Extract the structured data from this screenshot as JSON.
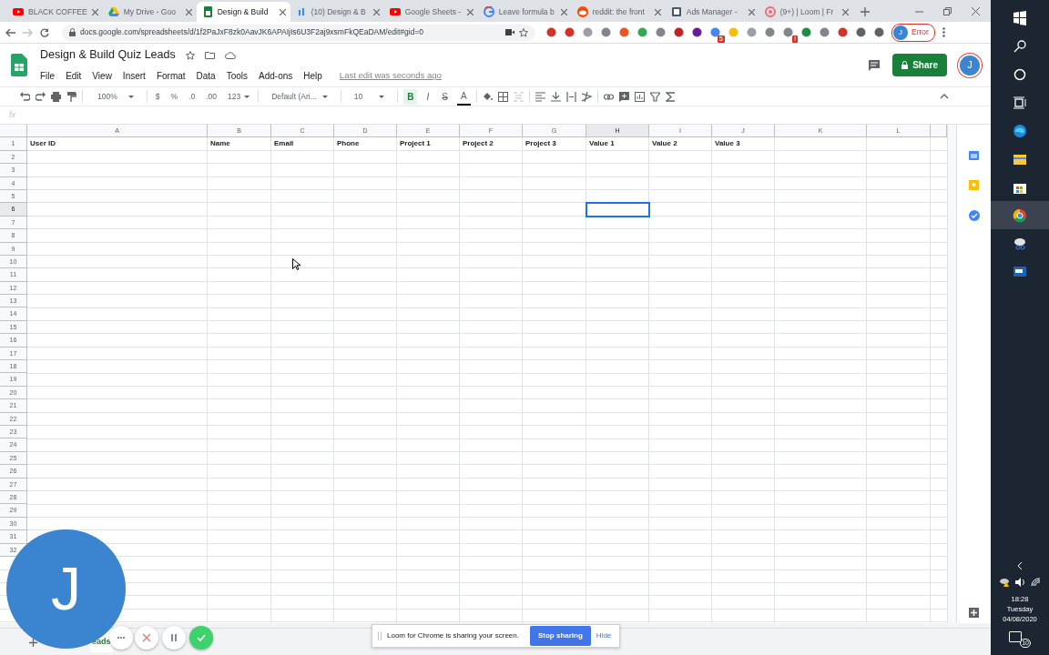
{
  "browser": {
    "tabs": [
      {
        "title": "BLACK COFFEE",
        "kind": "youtube",
        "selected": false
      },
      {
        "title": "My Drive - Goo",
        "kind": "drive",
        "selected": false
      },
      {
        "title": "Design & Build",
        "kind": "sheets",
        "selected": true
      },
      {
        "title": "(10) Design & B",
        "kind": "quiz",
        "selected": false
      },
      {
        "title": "Google Sheets -",
        "kind": "youtube",
        "selected": false
      },
      {
        "title": "Leave formula b",
        "kind": "google",
        "selected": false
      },
      {
        "title": "reddit: the front",
        "kind": "reddit",
        "selected": false
      },
      {
        "title": "Ads Manager -",
        "kind": "ads",
        "selected": false
      },
      {
        "title": "(9+) | Loom | Fr",
        "kind": "loom",
        "selected": false
      }
    ],
    "url": "docs.google.com/spreadsheets/d/1f2PaJxF8zk0AavJK6APAIjIs6U3F2aj9xsmFkQEaDAM/edit#gid=0",
    "extension_badges": [
      "5",
      "!"
    ],
    "profile": {
      "initial": "J",
      "status": "Error"
    }
  },
  "sheet": {
    "title": "Design & Build Quiz Leads",
    "menus": [
      "File",
      "Edit",
      "View",
      "Insert",
      "Format",
      "Data",
      "Tools",
      "Add-ons",
      "Help"
    ],
    "last_edit": "Last edit was seconds ago",
    "share": "Share",
    "avatar": "J",
    "toolbar": {
      "zoom": "100%",
      "currency": "$",
      "percent": "%",
      "decrease_decimal": ".0",
      "increase_decimal": ".00",
      "number_format": "123",
      "font": "Default (Ari...",
      "font_size": "10",
      "formatting": [
        {
          "label": "B",
          "kind": "bold",
          "on": true
        },
        {
          "label": "I",
          "kind": "italic",
          "on": false
        },
        {
          "label": "S",
          "kind": "strike",
          "on": false
        },
        {
          "label": "A",
          "kind": "color",
          "on": false
        }
      ]
    },
    "formula_bar": {
      "label": "fx"
    },
    "columns": [
      {
        "label": "A",
        "selected": false
      },
      {
        "label": "B",
        "selected": false
      },
      {
        "label": "C",
        "selected": false
      },
      {
        "label": "D",
        "selected": false
      },
      {
        "label": "E",
        "selected": false
      },
      {
        "label": "F",
        "selected": false
      },
      {
        "label": "G",
        "selected": false
      },
      {
        "label": "H",
        "selected": true
      },
      {
        "label": "I",
        "selected": false
      },
      {
        "label": "J",
        "selected": false
      },
      {
        "label": "K",
        "selected": false
      },
      {
        "label": "L",
        "selected": false
      }
    ],
    "rows": [
      {
        "label": "1",
        "selected": false
      },
      {
        "label": "2",
        "selected": false
      },
      {
        "label": "3",
        "selected": false
      },
      {
        "label": "4",
        "selected": false
      },
      {
        "label": "5",
        "selected": false
      },
      {
        "label": "6",
        "selected": true
      },
      {
        "label": "7",
        "selected": false
      },
      {
        "label": "8",
        "selected": false
      },
      {
        "label": "9",
        "selected": false
      },
      {
        "label": "10",
        "selected": false
      },
      {
        "label": "11",
        "selected": false
      },
      {
        "label": "12",
        "selected": false
      },
      {
        "label": "13",
        "selected": false
      },
      {
        "label": "14",
        "selected": false
      },
      {
        "label": "15",
        "selected": false
      },
      {
        "label": "16",
        "selected": false
      },
      {
        "label": "17",
        "selected": false
      },
      {
        "label": "18",
        "selected": false
      },
      {
        "label": "19",
        "selected": false
      },
      {
        "label": "20",
        "selected": false
      },
      {
        "label": "21",
        "selected": false
      },
      {
        "label": "22",
        "selected": false
      },
      {
        "label": "23",
        "selected": false
      },
      {
        "label": "24",
        "selected": false
      },
      {
        "label": "25",
        "selected": false
      },
      {
        "label": "26",
        "selected": false
      },
      {
        "label": "27",
        "selected": false
      },
      {
        "label": "28",
        "selected": false
      },
      {
        "label": "29",
        "selected": false
      },
      {
        "label": "30",
        "selected": false
      },
      {
        "label": "31",
        "selected": false
      },
      {
        "label": "32",
        "selected": false
      }
    ],
    "header_cells": [
      "User ID",
      "Name",
      "Email",
      "Phone",
      "Project 1",
      "Project 2",
      "Project 3",
      "Value 1",
      "Value 2",
      "Value 3"
    ],
    "sheet_tabs": [
      {
        "label": "eads"
      }
    ]
  },
  "loom": {
    "avatar": "J",
    "message": "Loom for Chrome is sharing your screen.",
    "stop": "Stop sharing",
    "hide": "Hide"
  },
  "taskbar": {
    "time": "18:28",
    "day": "Tuesday",
    "date": "04/08/2020",
    "notifications": "10"
  }
}
